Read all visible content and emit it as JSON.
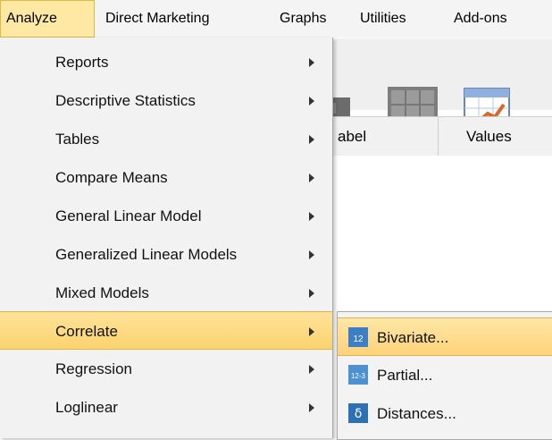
{
  "menubar": {
    "items": [
      {
        "label": "Analyze"
      },
      {
        "label": "Direct Marketing"
      },
      {
        "label": "Graphs"
      },
      {
        "label": "Utilities"
      },
      {
        "label": "Add-ons"
      }
    ]
  },
  "grid": {
    "columns": [
      {
        "label": "abel"
      },
      {
        "label": "Values"
      }
    ]
  },
  "analyze_menu": {
    "items": [
      {
        "label": "Reports"
      },
      {
        "label": "Descriptive Statistics"
      },
      {
        "label": "Tables"
      },
      {
        "label": "Compare Means"
      },
      {
        "label": "General Linear Model"
      },
      {
        "label": "Generalized Linear Models"
      },
      {
        "label": "Mixed Models"
      },
      {
        "label": "Correlate"
      },
      {
        "label": "Regression"
      },
      {
        "label": "Loglinear"
      }
    ]
  },
  "correlate_submenu": {
    "items": [
      {
        "label": "Bivariate...",
        "icon": "bivariate-icon"
      },
      {
        "label": "Partial...",
        "icon": "partial-icon"
      },
      {
        "label": "Distances...",
        "icon": "distances-icon"
      }
    ]
  },
  "colors": {
    "highlight": "#fbd36e",
    "menu_bg": "#f2f2f2"
  }
}
